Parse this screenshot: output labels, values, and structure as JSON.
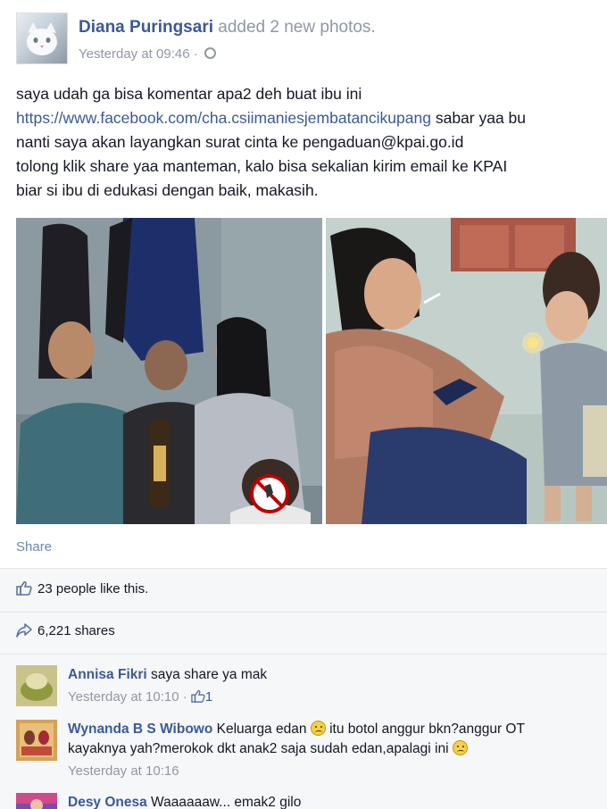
{
  "post": {
    "author": "Diana Puringsari",
    "action": "added 2 new photos.",
    "timestamp": "Yesterday at 09:46",
    "privacy_icon": "globe-icon",
    "lines": {
      "l1": "saya udah ga bisa komentar apa2 deh buat ibu ini",
      "l2_link": "https://www.facebook.com/cha.csiimaniesjembatancikupang",
      "l2_rest": " sabar yaa bu",
      "l3": "nanti saya akan layangkan surat cinta ke pengaduan@kpai.go.id",
      "l4": "tolong klik share yaa manteman, kalo bisa sekalian kirim email ke KPAI",
      "l5": "biar si ibu di edukasi dengan baik, makasih."
    }
  },
  "actions": {
    "share_label": "Share"
  },
  "stats": {
    "likes_text": "23 people like this.",
    "shares_text": "6,221 shares"
  },
  "comments": [
    {
      "name": "Annisa Fikri",
      "text": " saya share ya mak",
      "time": "Yesterday at 10:10",
      "sep": " · ",
      "like_count": "1"
    },
    {
      "name": "Wynanda B S Wibowo",
      "text_a": " Keluarga edan ",
      "text_b": " itu botol anggur bkn?anggur OT",
      "text_c": "kayaknya yah?merokok dkt anak2 saja sudah edan,apalagi ini ",
      "time": "Yesterday at 10:16"
    },
    {
      "name": "Desy Onesa",
      "text": " Waaaaaaw... emak2 gilo"
    }
  ],
  "colors": {
    "link": "#3b5998",
    "meta": "#9197a3",
    "band": "#f6f7f9"
  }
}
